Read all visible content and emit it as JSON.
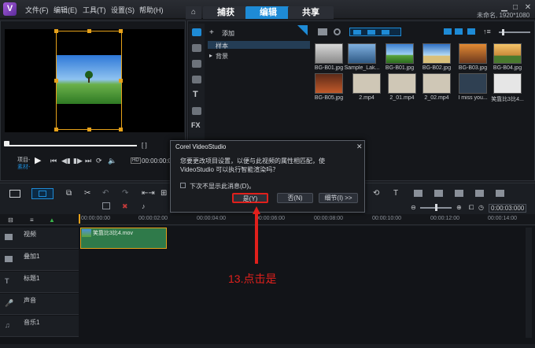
{
  "menu": [
    "文件(F)",
    "编辑(E)",
    "工具(T)",
    "设置(S)",
    "帮助(H)"
  ],
  "tabs": {
    "capture": "捕获",
    "edit": "编辑",
    "share": "共享"
  },
  "project_info": "未命名, 1920*1080",
  "library": {
    "add_label": "添加",
    "folders": [
      "样本",
      "背景"
    ],
    "thumbnails": [
      "BG-B01.jpg",
      "Sample_Lak...",
      "BG-B01.jpg",
      "BG-B02.jpg",
      "BG-B03.jpg",
      "BG-B04.jpg",
      "BG-B05.jpg",
      "2.mp4",
      "2_01.mp4",
      "2_02.mp4",
      "I miss you...",
      "笑靠比3比4..."
    ]
  },
  "player": {
    "project_label": "项目-",
    "clip_label": "素材-",
    "timecode": "00:00:00:00",
    "hd_label": "HD"
  },
  "dialog": {
    "title": "Corel VideoStudio",
    "message": "您要更改项目设置，以便与此视频的属性相匹配，使 VideoStudio 可以执行智能渲染吗？",
    "checkbox_label": "下次不显示此消息(D)。",
    "yes_label": "是(Y)",
    "no_label": "否(N)",
    "details_label": "细节(I) >>"
  },
  "zoom_timecode": "0:00:03:000",
  "ruler": [
    "00:00:00:00",
    "00:00:02:00",
    "00:00:04:00",
    "00:00:06:00",
    "00:00:08:00",
    "00:00:10:00",
    "00:00:12:00",
    "00:00:14:00"
  ],
  "tracks": [
    "视频",
    "叠加1",
    "标题1",
    "声音",
    "音乐1"
  ],
  "clip_name": "笑靠比3比4.mov",
  "annotation": "13.点击是",
  "colors": {
    "accent": "#1e8bd6",
    "clip": "#2f7a4a",
    "annotation": "#e0201c"
  }
}
